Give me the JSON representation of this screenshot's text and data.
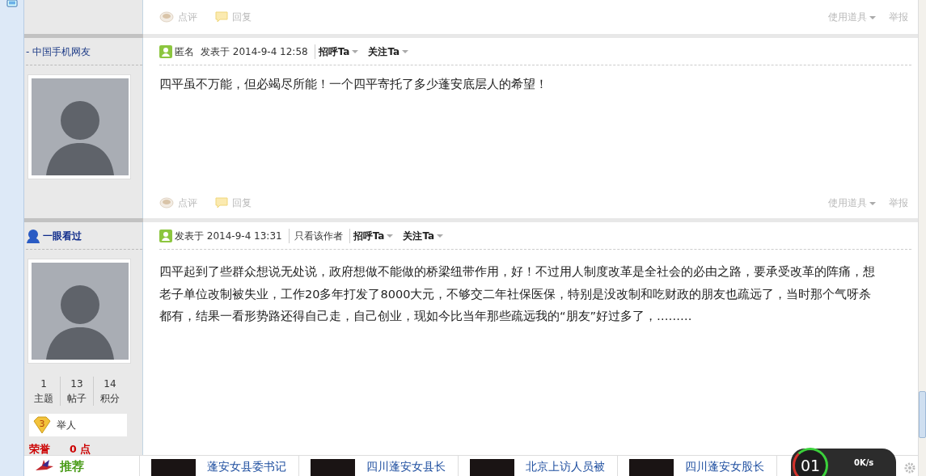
{
  "top_footer": {
    "actions": [
      {
        "label": "点评",
        "kind": "comment"
      },
      {
        "label": "回复",
        "kind": "reply"
      }
    ],
    "tools": "使用道具",
    "report": "举报"
  },
  "posts": [
    {
      "kind": "guest",
      "author": "- 中国手机网友",
      "header": [
        {
          "text": "匿名",
          "kind": "plain"
        },
        {
          "text": "发表于 2014-9-4 12:58",
          "kind": "plain"
        },
        {
          "text": "招呼Ta",
          "kind": "dropdown"
        },
        {
          "text": "关注Ta",
          "kind": "dropdown"
        }
      ],
      "lines": [
        "四平虽不万能，但必竭尽所能！一个四平寄托了多少蓬安底层人的希望！"
      ],
      "footer": {
        "actions": [
          {
            "label": "点评",
            "kind": "comment"
          },
          {
            "label": "回复",
            "kind": "reply"
          }
        ],
        "tools": "使用道具",
        "report": "举报"
      }
    },
    {
      "kind": "member",
      "author": "一眼看过",
      "header": [
        {
          "text": "发表于 2014-9-4 13:31",
          "kind": "plain"
        },
        {
          "text": "只看该作者",
          "kind": "link"
        },
        {
          "text": "招呼Ta",
          "kind": "dropdown"
        },
        {
          "text": "关注Ta",
          "kind": "dropdown"
        }
      ],
      "lines": [
        "四平起到了些群众想说无处说，政府想做不能做的桥梁纽带作用，好！不过用人制度改革是全社会的必由之路，要承受改革的阵痛，想",
        "老子单位改制被失业，工作20多年打发了8000大元，不够交二年社保医保，特别是没改制和吃财政的朋友也疏远了，当时那个气呀杀",
        "都有，结果一看形势路还得自己走，自己创业，现如今比当年那些疏远我的“朋友”好过多了，………"
      ],
      "stats": [
        {
          "value": "1",
          "label": "主题"
        },
        {
          "value": "13",
          "label": "帖子"
        },
        {
          "value": "14",
          "label": "积分"
        }
      ],
      "rank": {
        "level": "3",
        "title": "举人"
      },
      "honor": {
        "label": "荣誉",
        "value": "0 点"
      }
    }
  ],
  "recommend": {
    "title": "推荐",
    "items": [
      "蓬安女县委书记",
      "四川蓬安女县长",
      "北京上访人员被",
      "四川蓬安女股长"
    ]
  },
  "speed_widget": {
    "gauge": "01",
    "speed": "0K/s"
  }
}
